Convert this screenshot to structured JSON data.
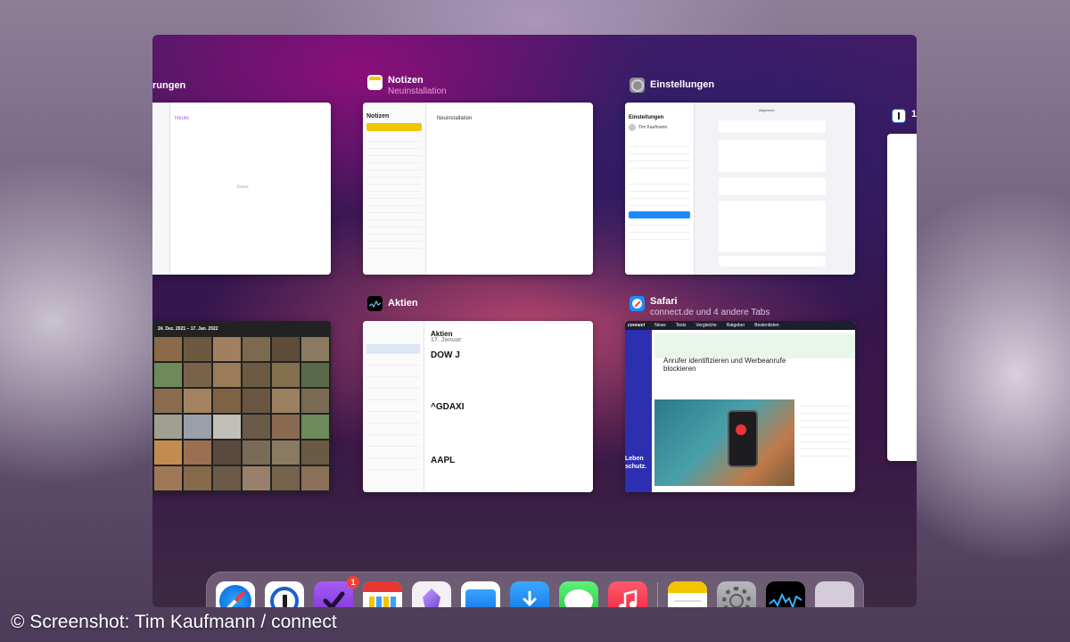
{
  "cards": {
    "partial_left": {
      "title_fragment": "rungen",
      "heading": "Heute",
      "empty": "Keine"
    },
    "notes": {
      "title": "Notizen",
      "subtitle": "Neuinstallation",
      "heading": "Notizen",
      "note_title": "Neuinstallation"
    },
    "settings": {
      "title": "Einstellungen",
      "heading": "Einstellungen",
      "user": "Tim Kaufmann",
      "section": "Allgemein",
      "selected_item": "Allgemein"
    },
    "photos": {
      "date_range": "24. Dez. 2021 – 17. Jan. 2022"
    },
    "stocks": {
      "title": "Aktien",
      "heading": "Aktien",
      "date": "17. Januar",
      "tickers": [
        "DOW J",
        "^GDAXI",
        "AAPL"
      ]
    },
    "safari": {
      "title": "Safari",
      "subtitle": "connect.de und 4 andere Tabs",
      "nav": [
        "connect",
        "News",
        "Tests",
        "Vergleiche",
        "Ratgeber",
        "Bestenlisten"
      ],
      "headline": "Anrufer identifizieren und Werbeanrufe blockieren",
      "side_promo": "Leben\nschutz."
    },
    "partial_right": {
      "label": "1"
    }
  },
  "dock": {
    "icons": [
      "safari-icon",
      "1password-icon",
      "omnifocus-icon",
      "fantastical-icon",
      "obsidian-icon",
      "files-icon",
      "app-store-download-icon",
      "messages-icon",
      "music-icon",
      "notes-icon",
      "settings-icon",
      "stocks-icon",
      "app-folder-icon"
    ],
    "omnifocus_badge": "1"
  },
  "credit": "© Screenshot: Tim Kaufmann / connect",
  "colors": {
    "accent": "#ff3b30",
    "notes_yellow": "#f5c400",
    "safari_blue": "#1a8cff"
  }
}
